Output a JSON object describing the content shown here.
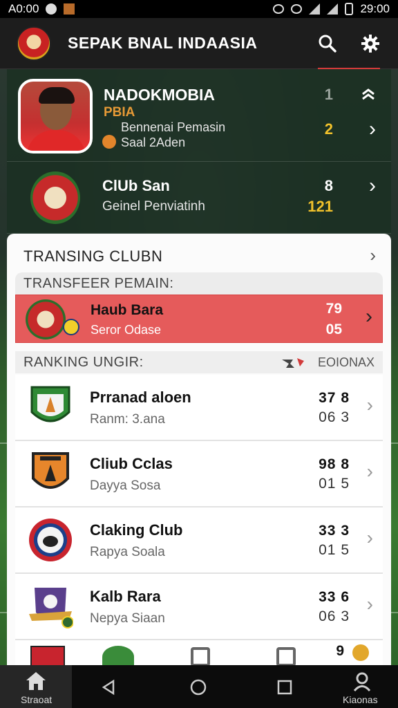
{
  "status_bar": {
    "time_left": "A0:00",
    "time_right": "29:00"
  },
  "app_bar": {
    "title": "SEPAK BNAL INDAASIA"
  },
  "featured_player": {
    "name": "NADOKMOBIA",
    "position": "PBIA",
    "line1": "Bennenai Pemasin",
    "line2": "Saal 2Aden",
    "num_top": "1",
    "num_bottom": "2"
  },
  "featured_club": {
    "name": "ClUb San",
    "sub": "Geinel Penviatinh",
    "num_top": "8",
    "num_bottom": "121"
  },
  "panel": {
    "title": "TRANSING CLUBN",
    "transfer_label": "TRANSFEER PEMAIN:",
    "transfer_item": {
      "name": "Haub Bara",
      "sub": "Seror Odase",
      "n1": "79",
      "n2": "05"
    },
    "ranking_label": "RANKING UNGIR:",
    "ranking_right": "EOIONAX",
    "ranking": [
      {
        "name": "Prranad aloen",
        "sub": "Ranm: 3.ana",
        "n1": "37 8",
        "n2": "06 3",
        "color": "#2f8a35"
      },
      {
        "name": "Cliub Cclas",
        "sub": "Dayya Sosa",
        "n1": "98 8",
        "n2": "01 5",
        "color": "#e7862b"
      },
      {
        "name": "Claking Club",
        "sub": "Rapya Soala",
        "n1": "33 3",
        "n2": "01 5",
        "color": "#c8242e"
      },
      {
        "name": "Kalb Rara",
        "sub": "Nepya Siaan",
        "n1": "33 6",
        "n2": "06 3",
        "color": "#5a3f8c"
      }
    ],
    "partial": {
      "n1": "9"
    }
  },
  "bottom_nav": {
    "home_label": "Straoat",
    "profile_label": "Kiaonas"
  },
  "icons": [
    "search-icon",
    "gear-icon",
    "chevron-right-icon",
    "home-icon",
    "back-icon",
    "circle-home-icon",
    "recents-icon",
    "person-icon"
  ]
}
